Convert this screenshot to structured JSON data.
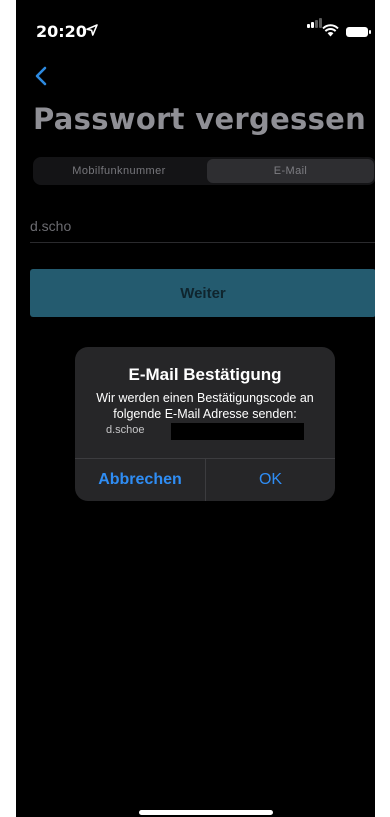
{
  "status_bar": {
    "time": "20:20"
  },
  "header": {
    "title": "Passwort vergessen"
  },
  "segments": [
    {
      "label": "Mobilfunknummer"
    },
    {
      "label": "E-Mail"
    }
  ],
  "email_field": {
    "value": "d.scho"
  },
  "primary_button": {
    "label": "Weiter"
  },
  "alert": {
    "title": "E-Mail Bestätigung",
    "message": "Wir werden einen Bestätigungscode an folgende E-Mail Adresse senden:",
    "email": "d.schoe",
    "cancel_label": "Abbrechen",
    "ok_label": "OK"
  },
  "colors": {
    "background": "#000000",
    "accent_button": "#245b6f",
    "alert_button_text": "#2f8df4",
    "back_chevron": "#2d8ae0"
  }
}
